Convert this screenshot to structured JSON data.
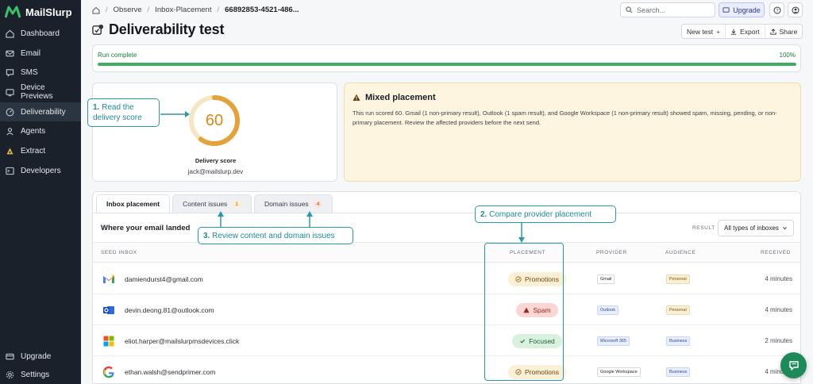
{
  "app": {
    "name": "MailSlurp"
  },
  "sidebar": {
    "items": [
      {
        "label": "Dashboard",
        "icon": "home-icon"
      },
      {
        "label": "Email",
        "icon": "envelope-icon"
      },
      {
        "label": "SMS",
        "icon": "chat-icon"
      },
      {
        "label": "Device Previews",
        "icon": "device-icon"
      },
      {
        "label": "Deliverability",
        "icon": "gauge-icon",
        "active": true
      },
      {
        "label": "Agents",
        "icon": "agent-icon"
      },
      {
        "label": "Extract",
        "icon": "extract-icon"
      },
      {
        "label": "Developers",
        "icon": "terminal-icon"
      }
    ],
    "bottom": [
      {
        "label": "Upgrade",
        "icon": "upgrade-icon"
      },
      {
        "label": "Settings",
        "icon": "gear-icon"
      }
    ]
  },
  "breadcrumb": [
    "Observe",
    "Inbox-Placement",
    "66892853-4521-486..."
  ],
  "topbar": {
    "search_placeholder": "Search...",
    "upgrade_label": "Upgrade"
  },
  "page": {
    "title": "Deliverability test",
    "actions": {
      "new_test": "New test",
      "export": "Export",
      "share": "Share"
    }
  },
  "progress": {
    "label": "Run complete",
    "percent_text": "100%",
    "fraction": 1.0
  },
  "score": {
    "value": "60",
    "fraction": 0.6,
    "label": "Delivery score",
    "email": "jack@mailslurp.dev",
    "color": "#e3a33a"
  },
  "mixed": {
    "title": "Mixed placement",
    "text": "This run scored 60. Gmail (1 non-primary result), Outlook (1 spam result), and Google Workspace (1 non-primary result) showed spam, missing, pending, or non-primary placement. Review the affected providers before the next send."
  },
  "tabs": [
    {
      "label": "Inbox placement",
      "active": true
    },
    {
      "label": "Content issues",
      "badge": "1"
    },
    {
      "label": "Domain issues",
      "badge": "4"
    }
  ],
  "section_title": "Where your email landed",
  "result_filter": {
    "label": "RESULT",
    "value": "All types of inboxes"
  },
  "table": {
    "headers": {
      "seed_inbox": "SEED INBOX",
      "placement": "PLACEMENT",
      "provider": "PROVIDER",
      "audience": "AUDIENCE",
      "received": "RECEIVED"
    },
    "rows": [
      {
        "email": "damiendurst4@gmail.com",
        "icon": "gmail-icon",
        "placement": "Promotions",
        "placement_type": "promo",
        "provider": "Gmail",
        "audience": "Personal",
        "received": "4 minutes"
      },
      {
        "email": "devin.deong.81@outlook.com",
        "icon": "outlook-icon",
        "placement": "Spam",
        "placement_type": "spam",
        "provider": "Outlook",
        "audience": "Personal",
        "received": "4 minutes"
      },
      {
        "email": "eliot.harper@mailslurpmsdevices.click",
        "icon": "microsoft-icon",
        "placement": "Focused",
        "placement_type": "focused",
        "provider": "Microsoft 365",
        "audience": "Business",
        "received": "2 minutes"
      },
      {
        "email": "ethan.walsh@sendprimer.com",
        "icon": "google-icon",
        "placement": "Promotions",
        "placement_type": "promo",
        "provider": "Google Workspace",
        "audience": "Business",
        "received": "4 minutes"
      }
    ]
  },
  "callouts": {
    "c1_num": "1.",
    "c1_text_a": "Read the",
    "c1_text_b": "delivery score",
    "c2_num": "2.",
    "c2_text": "Compare provider placement",
    "c3_num": "3.",
    "c3_text": "Review content and domain issues"
  },
  "colors": {
    "accent": "#2a9aa6",
    "success": "#3fae62",
    "sidebar": "#1a212b"
  }
}
